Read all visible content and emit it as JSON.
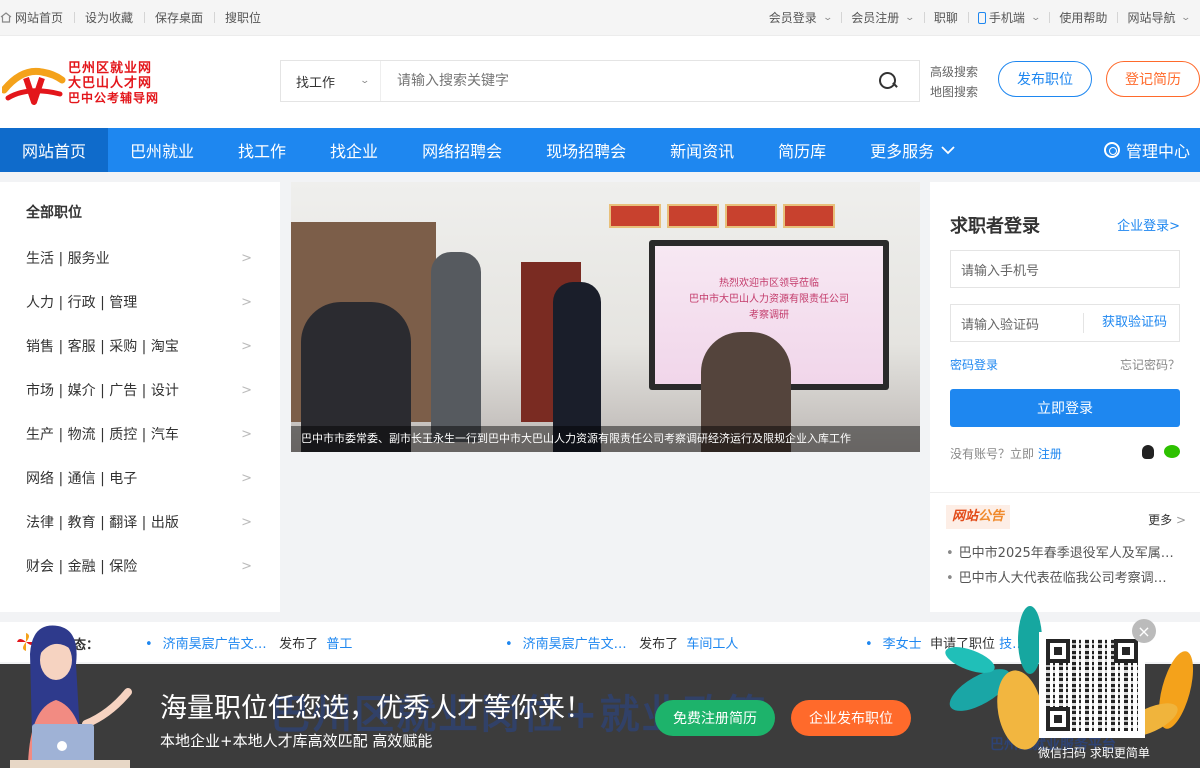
{
  "topbar": {
    "left": [
      "网站首页",
      "设为收藏",
      "保存桌面",
      "搜职位"
    ],
    "right": [
      "会员登录",
      "会员注册",
      "职聊",
      "手机端",
      "使用帮助",
      "网站导航"
    ]
  },
  "logo": {
    "line1": "巴州区就业网",
    "line2": "大巴山人才网",
    "line3": "巴中公考辅导网"
  },
  "search": {
    "type": "找工作",
    "placeholder": "请输入搜索关键字",
    "advanced": "高级搜索",
    "map": "地图搜索"
  },
  "header_buttons": {
    "post": "发布职位",
    "resume": "登记简历"
  },
  "nav": {
    "items": [
      "网站首页",
      "巴州就业",
      "找工作",
      "找企业",
      "网络招聘会",
      "现场招聘会",
      "新闻资讯",
      "简历库",
      "更多服务"
    ],
    "manage": "管理中心"
  },
  "categories": {
    "all": "全部职位",
    "items": [
      "生活 | 服务业",
      "人力 | 行政 | 管理",
      "销售 | 客服 | 采购 | 淘宝",
      "市场 | 媒介 | 广告 | 设计",
      "生产 | 物流 | 质控 | 汽车",
      "网络 | 通信 | 电子",
      "法律 | 教育 | 翻译 | 出版",
      "财会 | 金融 | 保险"
    ]
  },
  "banner": {
    "caption": "巴中市市委常委、副市长王永生一行到巴中市大巴山人力资源有限责任公司考察调研经济运行及限规企业入库工作",
    "screen_line1": "热烈欢迎市区领导莅临",
    "screen_line2": "巴中市大巴山人力资源有限责任公司",
    "screen_line3": "考察调研"
  },
  "login": {
    "title": "求职者登录",
    "enterprise_link": "企业登录>",
    "phone_placeholder": "请输入手机号",
    "code_placeholder": "请输入验证码",
    "get_code": "获取验证码",
    "password_login": "密码登录",
    "forgot": "忘记密码？",
    "submit": "立即登录",
    "no_account": "没有账号？立即",
    "register": "注册"
  },
  "notice": {
    "tag_a": "网站",
    "tag_b": "公告",
    "more": "更多",
    "items": [
      "巴中市2025年春季退役军人及军属…",
      "巴中市人大代表莅临我公司考察调…"
    ]
  },
  "dynamics": {
    "label": "动态：",
    "items": [
      {
        "who": "济南昊宸广告文…",
        "verb": "发布了",
        "what": "普工"
      },
      {
        "who": "济南昊宸广告文…",
        "verb": "发布了",
        "what": "车间工人"
      },
      {
        "who": "李女士",
        "verb": "申请了职位",
        "what": "技…"
      }
    ]
  },
  "promo": {
    "headline": "海量职位任您选，优秀人才等你来！",
    "sub": "本地企业+本地人才库高效匹配 高效赋能",
    "btn_resume": "免费注册简历",
    "btn_post": "企业发布职位",
    "bg_text": "巴州区就业岗位+就业政策",
    "bg_text2": "巴州区就业服务平台",
    "qr_caption": "微信扫码 求职更简单",
    "close": "×"
  }
}
